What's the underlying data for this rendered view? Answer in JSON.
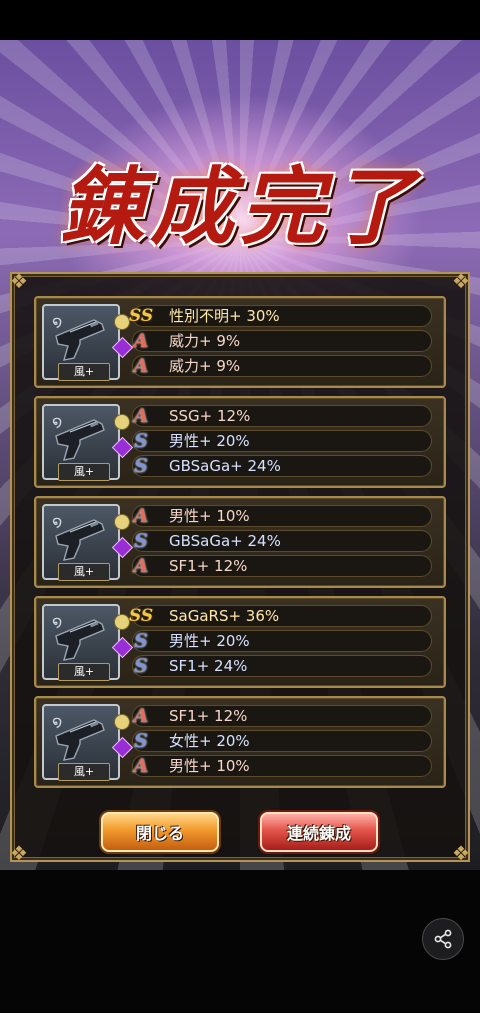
{
  "title": "錬成完了",
  "cards": [
    {
      "weapon_tag": "風+",
      "effects": [
        {
          "rank": "SS",
          "text": "性別不明+ 30%"
        },
        {
          "rank": "A",
          "text": "威力+ 9%"
        },
        {
          "rank": "A",
          "text": "威力+ 9%"
        }
      ]
    },
    {
      "weapon_tag": "風+",
      "effects": [
        {
          "rank": "A",
          "text": "SSG+ 12%"
        },
        {
          "rank": "S",
          "text": "男性+ 20%"
        },
        {
          "rank": "S",
          "text": "GBSaGa+ 24%"
        }
      ]
    },
    {
      "weapon_tag": "風+",
      "effects": [
        {
          "rank": "A",
          "text": "男性+ 10%"
        },
        {
          "rank": "S",
          "text": "GBSaGa+ 24%"
        },
        {
          "rank": "A",
          "text": "SF1+ 12%"
        }
      ]
    },
    {
      "weapon_tag": "風+",
      "effects": [
        {
          "rank": "SS",
          "text": "SaGaRS+ 36%"
        },
        {
          "rank": "S",
          "text": "男性+ 20%"
        },
        {
          "rank": "S",
          "text": "SF1+ 24%"
        }
      ]
    },
    {
      "weapon_tag": "風+",
      "effects": [
        {
          "rank": "A",
          "text": "SF1+ 12%"
        },
        {
          "rank": "S",
          "text": "女性+ 20%"
        },
        {
          "rank": "A",
          "text": "男性+ 10%"
        }
      ]
    }
  ],
  "buttons": {
    "close": "閉じる",
    "continue": "連続錬成"
  },
  "icons": {
    "share": "share-icon"
  }
}
